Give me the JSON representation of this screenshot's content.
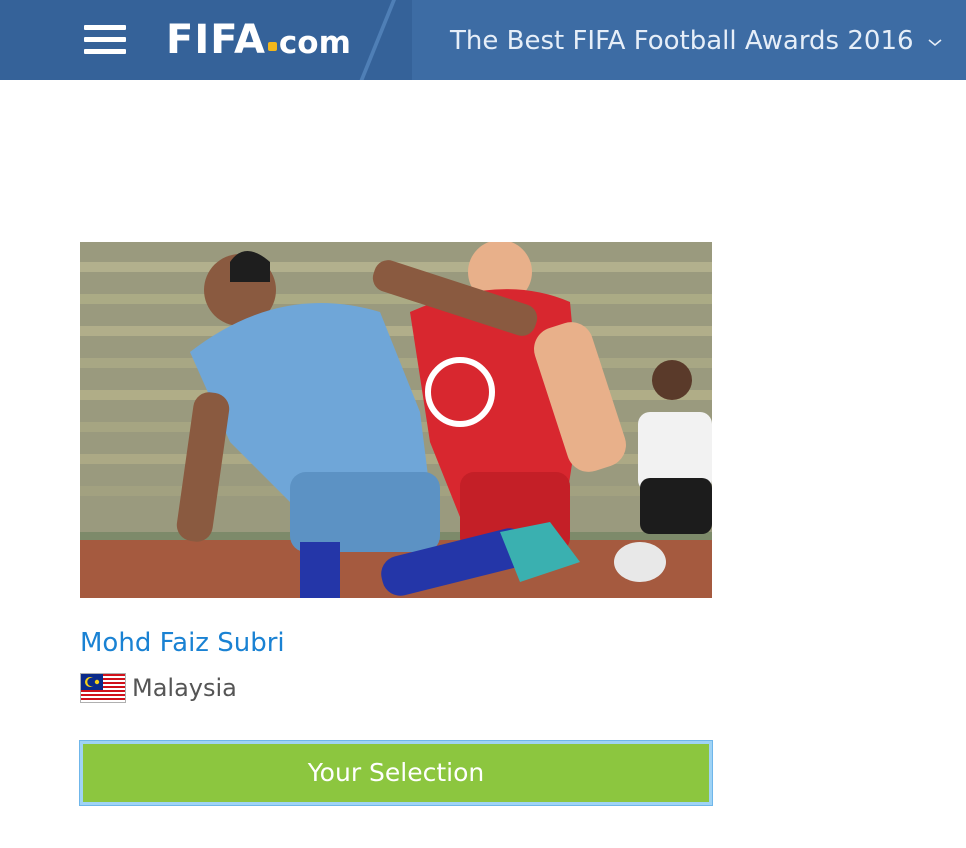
{
  "header": {
    "menu_icon": "hamburger-menu-icon",
    "logo": {
      "brand": "FIFA",
      "suffix": "com",
      "dot_color": "#f3b71b"
    },
    "event_title": "The Best FIFA Football Awards 2016",
    "dropdown_icon": "chevron-down-icon",
    "bar_color": "#356299"
  },
  "nominee": {
    "photo_icon": "player-photo",
    "name": "Mohd Faiz Subri",
    "country": "Malaysia",
    "flag_icon": "malaysia-flag-icon",
    "name_color": "#1a82d3"
  },
  "selection": {
    "button_label": "Your Selection",
    "button_color": "#8cc63f"
  }
}
